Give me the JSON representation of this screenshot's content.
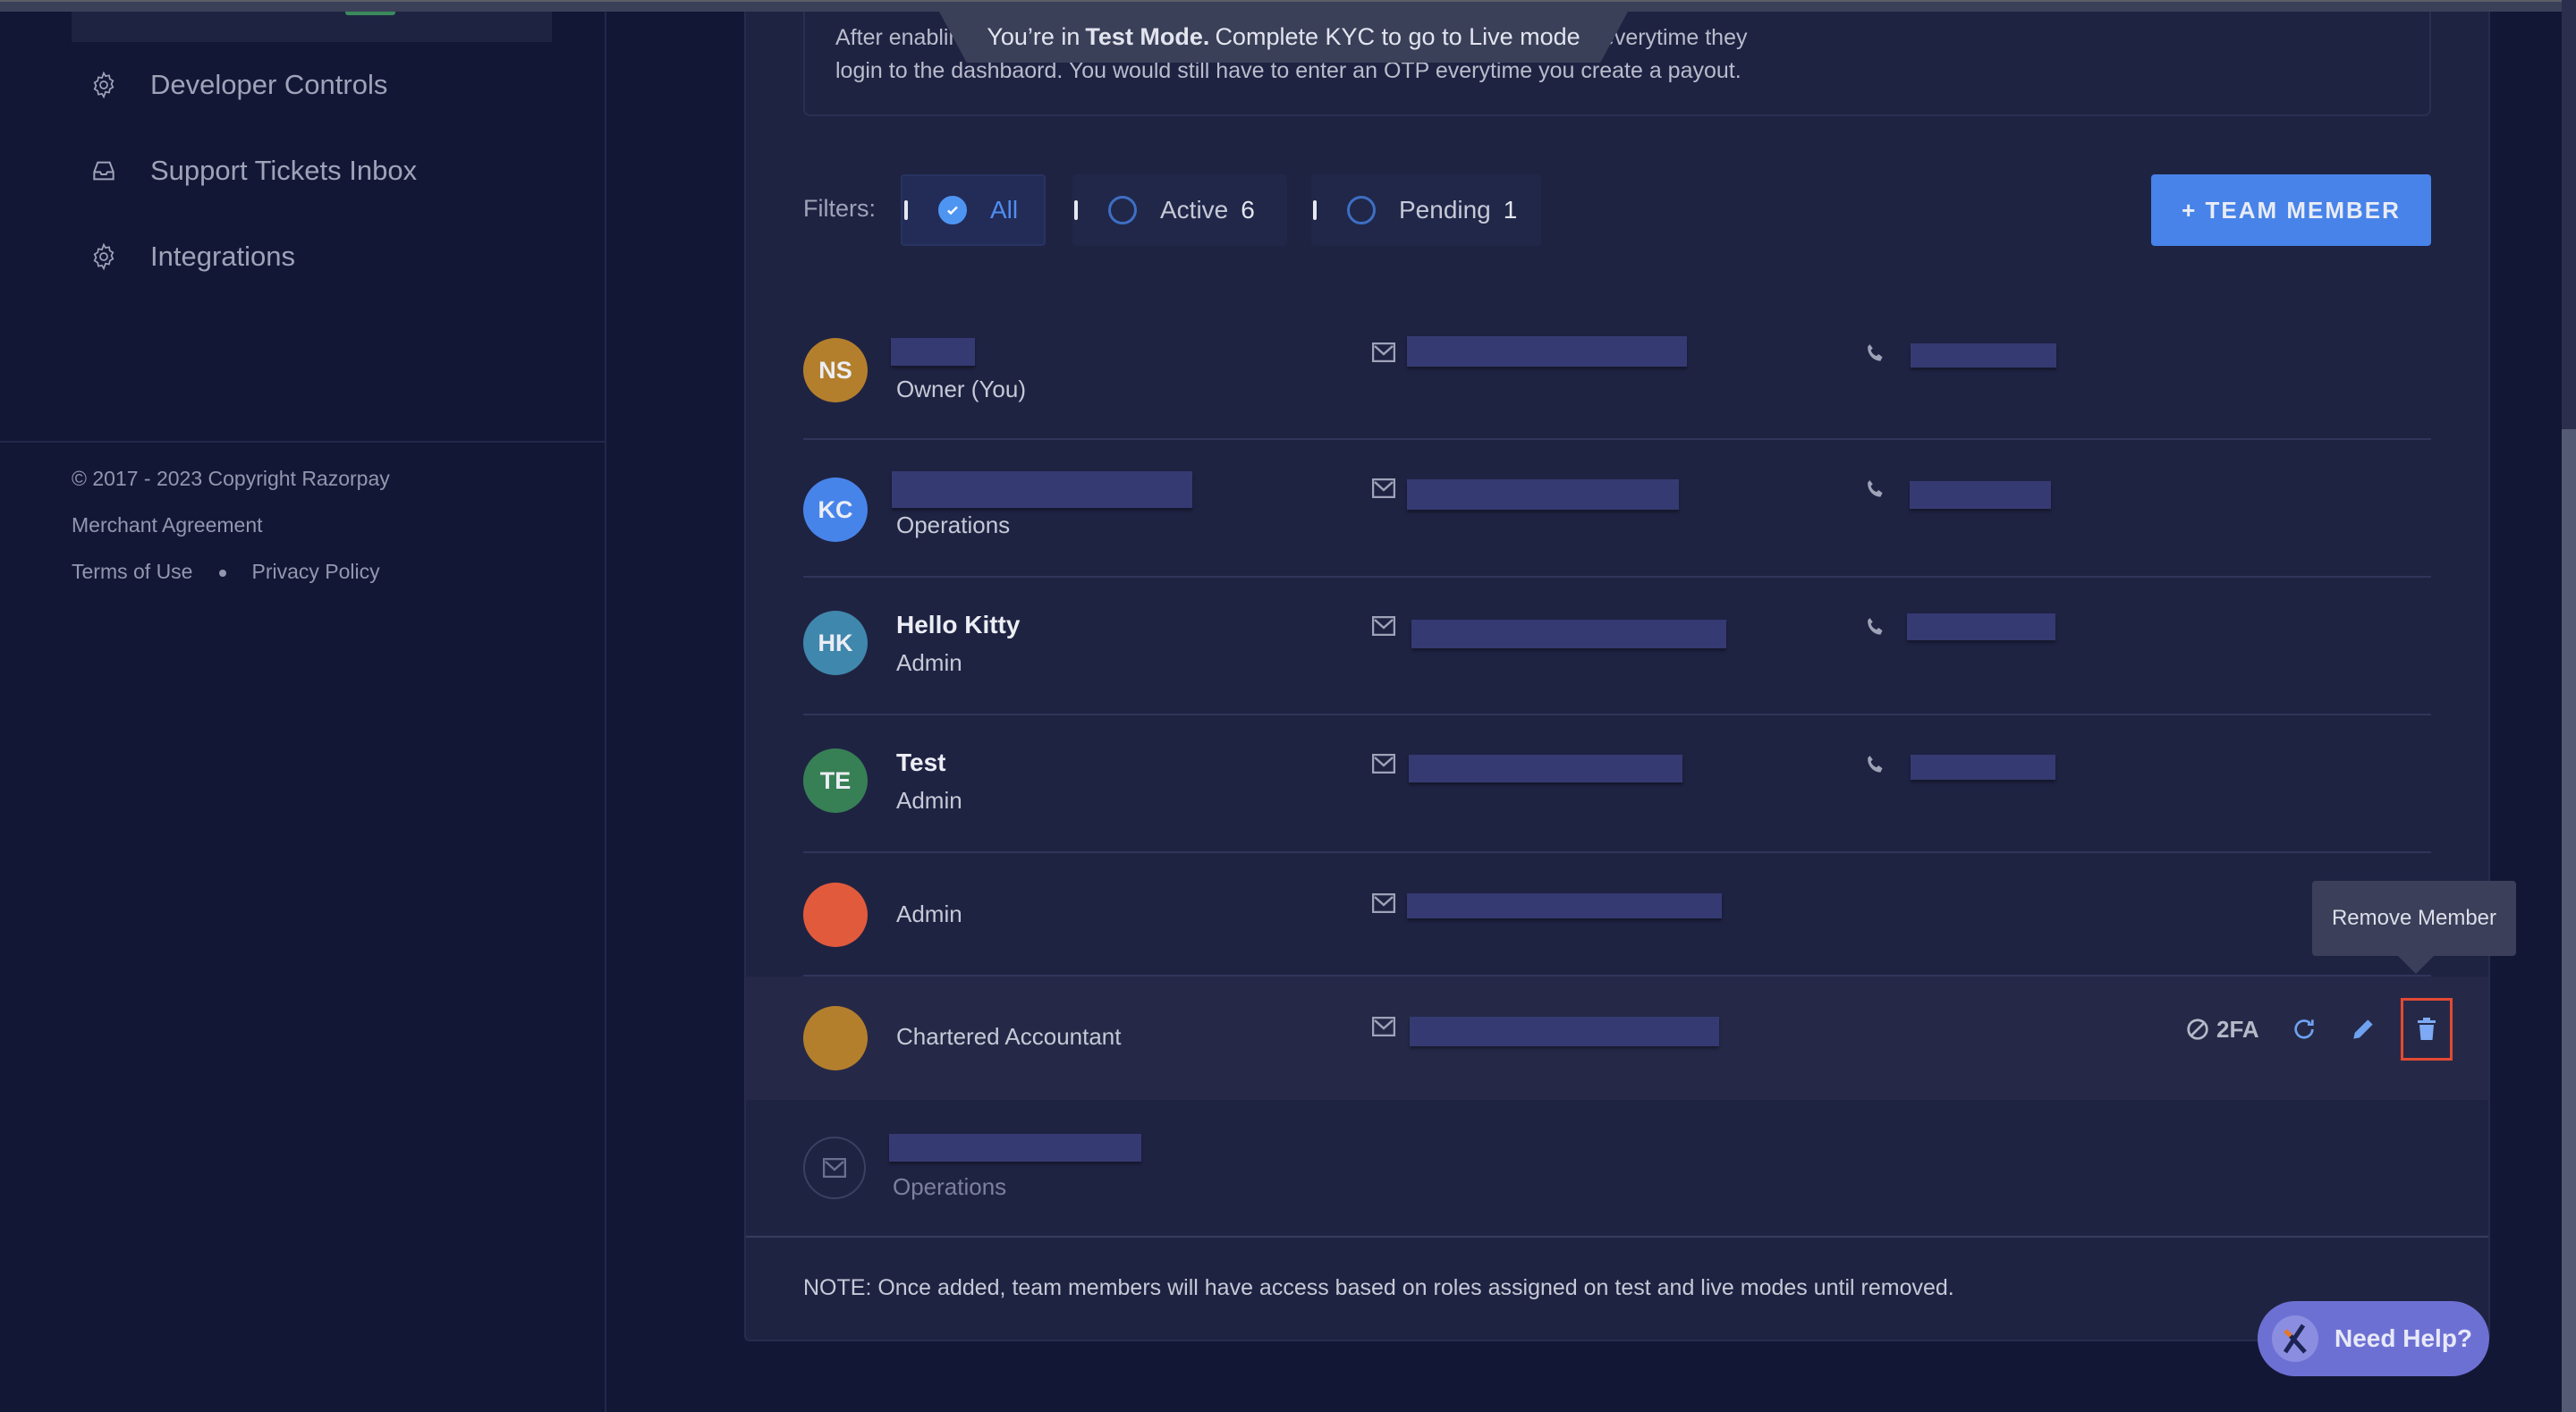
{
  "banner": {
    "prefix": "You’re in",
    "mode": "Test Mode.",
    "suffix": "Complete KYC to go to Live mode"
  },
  "sidebar": {
    "items": [
      {
        "label": "Developer Controls",
        "icon": "gear-icon"
      },
      {
        "label": "Support Tickets Inbox",
        "icon": "inbox-icon"
      },
      {
        "label": "Integrations",
        "icon": "gear-icon"
      }
    ],
    "footer": {
      "copyright": "© 2017 - 2023 Copyright Razorpay",
      "merchant_agreement": "Merchant Agreement",
      "terms": "Terms of Use",
      "privacy": "Privacy Policy"
    }
  },
  "info": {
    "line1": "After enabling 2FA, team members will have an additional OTP login process everytime they",
    "line2": "login to the dashbaord. You would still have to enter an OTP everytime you create a payout."
  },
  "filters": {
    "label": "Filters:",
    "options": [
      {
        "label": "All",
        "count": "",
        "selected": true
      },
      {
        "label": "Active",
        "count": "6",
        "selected": false
      },
      {
        "label": "Pending",
        "count": "1",
        "selected": false
      }
    ]
  },
  "add_member_label": "+ TEAM MEMBER",
  "members": [
    {
      "initials": "NS",
      "name": "[redacted]",
      "role": "Owner (You)",
      "color": "#b47f2c",
      "email": "[redacted]",
      "phone": "[redacted]"
    },
    {
      "initials": "KC",
      "name": "[redacted]",
      "role": "Operations",
      "color": "#4784ea",
      "email": "[redacted]",
      "phone": "[redacted]"
    },
    {
      "initials": "HK",
      "name": "Hello Kitty",
      "role": "Admin",
      "color": "#3f87ac",
      "email": "[redacted]",
      "phone": "[redacted]"
    },
    {
      "initials": "TE",
      "name": "Test",
      "role": "Admin",
      "color": "#378055",
      "email": "[redacted]",
      "phone": "[redacted]"
    },
    {
      "initials": "",
      "name": "",
      "role": "Admin",
      "color": "#e25a3c",
      "email": "[redacted]",
      "phone": ""
    },
    {
      "initials": "",
      "name": "",
      "role": "Chartered Accountant",
      "color": "#b47f2c",
      "email": "[redacted]",
      "phone": ""
    }
  ],
  "pending_member": {
    "email": "[redacted]",
    "role": "Operations"
  },
  "row_actions": {
    "twofa_label": "2FA",
    "tooltip": "Remove Member"
  },
  "note": "NOTE: Once added, team members will have access based on roles assigned on test and live modes until removed.",
  "help_label": "Need Help?"
}
